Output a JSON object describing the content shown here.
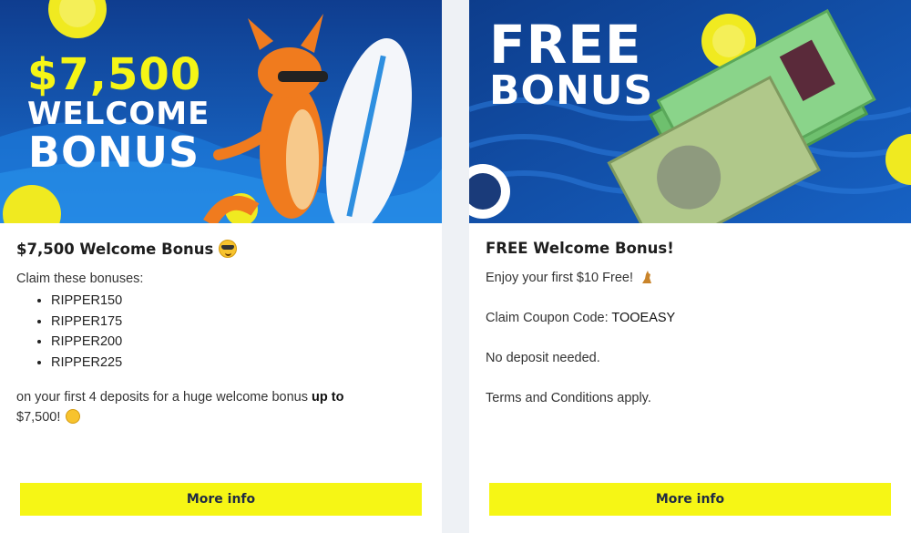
{
  "offers": [
    {
      "banner": {
        "amount": "$7,500",
        "line1": "WELCOME",
        "line2": "BONUS"
      },
      "title": "$7,500 Welcome Bonus",
      "title_emoji": "smiling-face-with-sunglasses-icon",
      "intro": "Claim these bonuses:",
      "codes": [
        "RIPPER150",
        "RIPPER175",
        "RIPPER200",
        "RIPPER225"
      ],
      "outro_prefix": "on your first 4 deposits for a huge welcome bonus ",
      "outro_bold": "up to",
      "outro_suffix": "$7,500!",
      "outro_emoji": "astonished-face-icon",
      "button_label": "More info"
    },
    {
      "banner": {
        "line1": "FREE",
        "line2": "BONUS"
      },
      "title": "FREE Welcome Bonus!",
      "line1": "Enjoy your first $10 Free!",
      "line1_emoji": "kangaroo-icon",
      "coupon_prefix": "Claim Coupon Code: ",
      "coupon_code": "TOOEASY",
      "line3": "No deposit needed.",
      "line4": "Terms and Conditions apply.",
      "button_label": "More info"
    }
  ],
  "colors": {
    "accent_yellow": "#f6f615",
    "banner_blue": "#1a4fa8",
    "page_bg": "#eef1f5"
  }
}
